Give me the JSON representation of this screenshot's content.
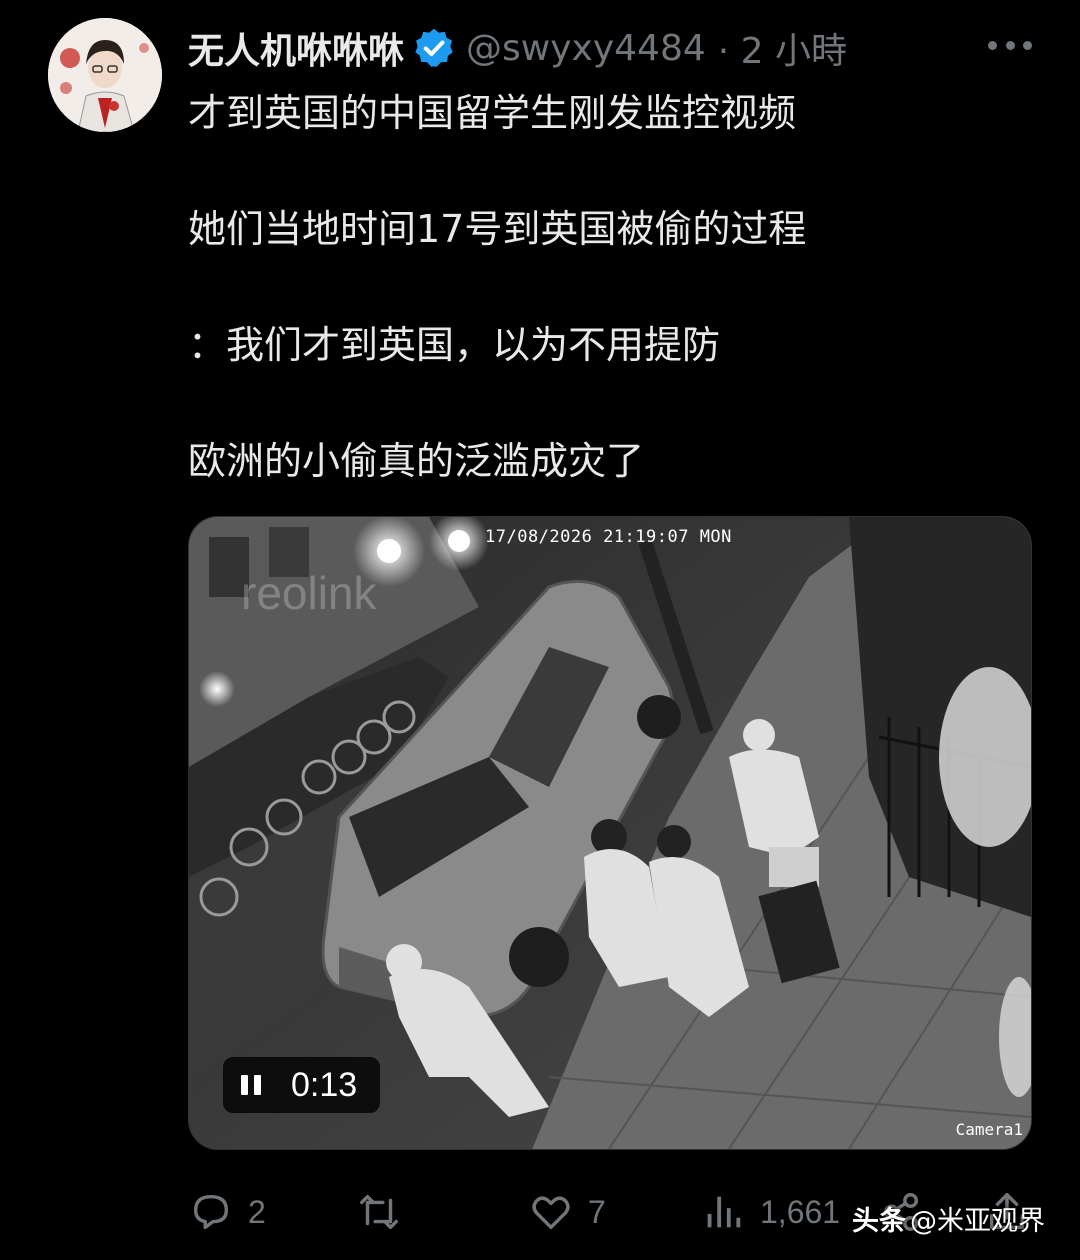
{
  "tweet": {
    "display_name": "无人机咻咻咻",
    "handle": "@swyxy4484",
    "time_ago": "· 2 小時",
    "paragraphs": [
      "才到英国的中国留学生刚发监控视频",
      "她们当地时间17号到英国被偷的过程",
      "：我们才到英国，以为不用提防",
      "欧洲的小偷真的泛滥成灾了"
    ]
  },
  "media": {
    "timestamp_overlay": "17/08/2026 21:19:07 MON",
    "camera_label": "Camera1",
    "watermark_brand": "reolink",
    "video_time": "0:13"
  },
  "actions": {
    "replies": "2",
    "reposts": "",
    "likes": "7",
    "views": "1,661"
  },
  "watermark": {
    "logo": "头条",
    "text": "@米亚观界"
  },
  "colors": {
    "background": "#000000",
    "text": "#e7e9ea",
    "secondary": "#71767b",
    "verified": "#1d9bf0"
  },
  "icons": [
    "more-icon",
    "verified-badge-icon",
    "reply-icon",
    "repost-icon",
    "like-icon",
    "views-icon",
    "share-icon",
    "pause-icon"
  ]
}
